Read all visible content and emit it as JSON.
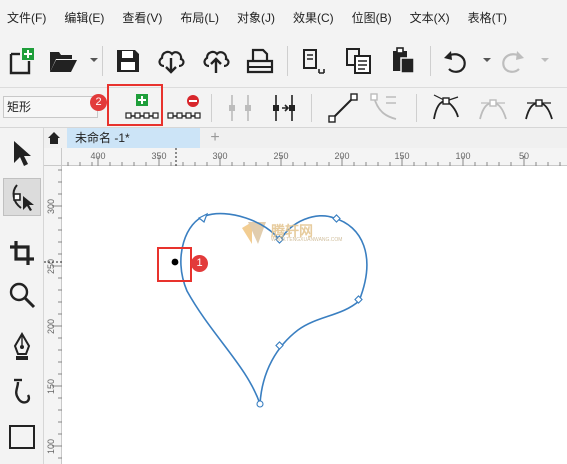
{
  "menubar": {
    "items": [
      "文件(F)",
      "编辑(E)",
      "查看(V)",
      "布局(L)",
      "对象(J)",
      "效果(C)",
      "位图(B)",
      "文本(X)",
      "表格(T)"
    ]
  },
  "propbar": {
    "shape_select": "矩形"
  },
  "annotations": {
    "badge_1": "1",
    "badge_2": "2"
  },
  "tabs": {
    "document": "未命名 -1*",
    "add": "+"
  },
  "rulers": {
    "horizontal": [
      "400",
      "350",
      "300",
      "250",
      "200",
      "150",
      "100",
      "50"
    ],
    "vertical": [
      "300",
      "250",
      "200",
      "150",
      "100"
    ]
  },
  "watermark": {
    "text": "腾轩网",
    "subtext": "WWW.TENGXUANWANG.COM"
  },
  "colors": {
    "accent_red": "#e23b3b",
    "curve_blue": "#3a7fc1",
    "tab_active": "#cce4f7",
    "add_node_green": "#1e9e3a",
    "delete_node_red": "#d8262b"
  },
  "icons": {
    "toolbar": [
      "new-document-icon",
      "open-folder-icon",
      "save-icon",
      "cloud-download-icon",
      "cloud-upload-icon",
      "print-icon",
      "copy-icon",
      "paste-icon",
      "clipboard-icon",
      "undo-icon",
      "redo-icon"
    ],
    "toolbox": [
      "pick-tool-icon",
      "shape-tool-icon",
      "crop-tool-icon",
      "zoom-tool-icon",
      "pen-tool-icon",
      "curve-tool-icon",
      "rectangle-tool-icon"
    ]
  }
}
